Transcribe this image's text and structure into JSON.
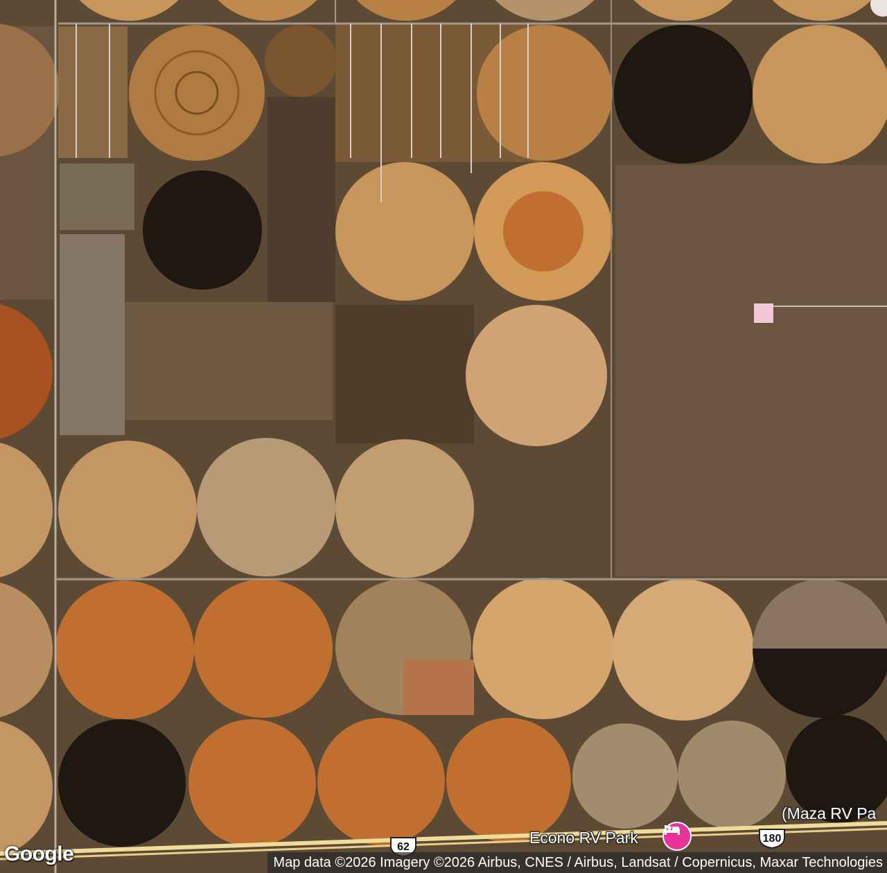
{
  "map": {
    "view": "satellite",
    "labels": {
      "econo_rv_park": "Econo RV Park",
      "maza_rv_park": "(Maza RV Pa"
    },
    "highway_shields": {
      "us_62": "62",
      "us_180": "180"
    },
    "logo": "Google",
    "attribution": "Map data ©2026 Imagery ©2026 Airbus, CNES / Airbus, Landsat / Copernicus, Maxar Technologies",
    "icons": {
      "poi": "hotel-bed-icon"
    },
    "colors": {
      "poi_pin": "#e8339a",
      "field_dark": "#1e1712",
      "field_tan": "#c8955a",
      "field_orange": "#c06f30",
      "scrub": "#5d4a35"
    }
  }
}
